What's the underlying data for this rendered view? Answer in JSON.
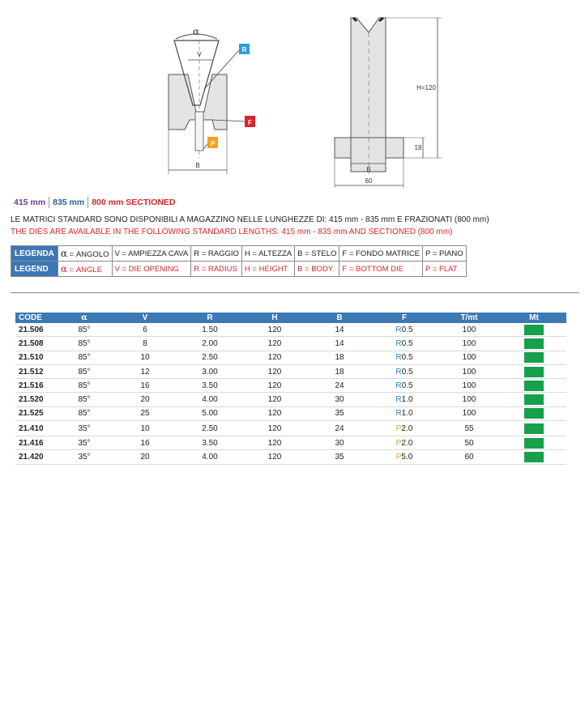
{
  "diagram_left": {
    "alpha_label": "α",
    "v_label": "V",
    "b_label": "B",
    "r_badge": {
      "text": "R",
      "color": "#2a9fd8"
    },
    "f_badge": {
      "text": "F",
      "color": "#d9262b"
    },
    "p_badge": {
      "text": "P",
      "color": "#f0a020"
    }
  },
  "diagram_right": {
    "h_label": "H=120",
    "b_label": "B",
    "height_label": "18",
    "width_label": "60"
  },
  "lengths": {
    "len1": "415 mm",
    "len2": "835 mm",
    "len3": "800 mm SECTIONED"
  },
  "notes": {
    "italian": "LE MATRICI STANDARD SONO DISPONIBILI A MAGAZZINO NELLE LUNGHEZZE DI: 415 mm - 835 mm E FRAZIONATI (800 mm)",
    "english": "THE DIES ARE AVAILABLE  IN THE FOLLOWING STANDARD LENGTHS: 415 mm - 835 mm AND SECTIONED (800 mm)"
  },
  "legend": {
    "it": {
      "head": "LEGENDA",
      "alpha": "α",
      "alpha_text": " = ANGOLO",
      "v": "V = AMPIEZZA CAVA",
      "r": "R = RAGGIO",
      "h": "H = ALTEZZA",
      "b": "B = STELO",
      "f": "F = FONDO MATRICE",
      "p": "P = PIANO"
    },
    "en": {
      "head": "LEGEND",
      "alpha": "α",
      "alpha_text": " = ANGLE",
      "v": "V = DIE OPENING",
      "r": "R = RADIUS",
      "h": "H = HEIGHT",
      "b": "B = BODY",
      "f": "F = BOTTOM DIE",
      "p": "P = FLAT"
    }
  },
  "table": {
    "headers": [
      "CODE",
      "α",
      "V",
      "R",
      "H",
      "B",
      "F",
      "T/mt",
      "Mt"
    ],
    "rows": [
      {
        "code": "21.506",
        "alpha": "85°",
        "v": "6",
        "r": "1.50",
        "h": "120",
        "b": "14",
        "f_letter": "R",
        "f_value": "0.5",
        "t": "100"
      },
      {
        "code": "21.508",
        "alpha": "85°",
        "v": "8",
        "r": "2.00",
        "h": "120",
        "b": "14",
        "f_letter": "R",
        "f_value": "0.5",
        "t": "100"
      },
      {
        "code": "21.510",
        "alpha": "85°",
        "v": "10",
        "r": "2.50",
        "h": "120",
        "b": "18",
        "f_letter": "R",
        "f_value": "0.5",
        "t": "100"
      },
      {
        "code": "21.512",
        "alpha": "85°",
        "v": "12",
        "r": "3.00",
        "h": "120",
        "b": "18",
        "f_letter": "R",
        "f_value": "0.5",
        "t": "100"
      },
      {
        "code": "21.516",
        "alpha": "85°",
        "v": "16",
        "r": "3.50",
        "h": "120",
        "b": "24",
        "f_letter": "R",
        "f_value": "0.5",
        "t": "100"
      },
      {
        "code": "21.520",
        "alpha": "85°",
        "v": "20",
        "r": "4.00",
        "h": "120",
        "b": "30",
        "f_letter": "R",
        "f_value": "1.0",
        "t": "100"
      },
      {
        "code": "21.525",
        "alpha": "85°",
        "v": "25",
        "r": "5.00",
        "h": "120",
        "b": "35",
        "f_letter": "R",
        "f_value": "1.0",
        "t": "100"
      },
      {
        "code": "21.410",
        "alpha": "35°",
        "v": "10",
        "r": "2.50",
        "h": "120",
        "b": "24",
        "f_letter": "P",
        "f_value": "2.0",
        "t": "55"
      },
      {
        "code": "21.416",
        "alpha": "35°",
        "v": "16",
        "r": "3.50",
        "h": "120",
        "b": "30",
        "f_letter": "P",
        "f_value": "2.0",
        "t": "50"
      },
      {
        "code": "21.420",
        "alpha": "35°",
        "v": "20",
        "r": "4.00",
        "h": "120",
        "b": "35",
        "f_letter": "P",
        "f_value": "5.0",
        "t": "60"
      }
    ],
    "mt_color": "#16a04b",
    "header_color": "#3c78b4"
  }
}
